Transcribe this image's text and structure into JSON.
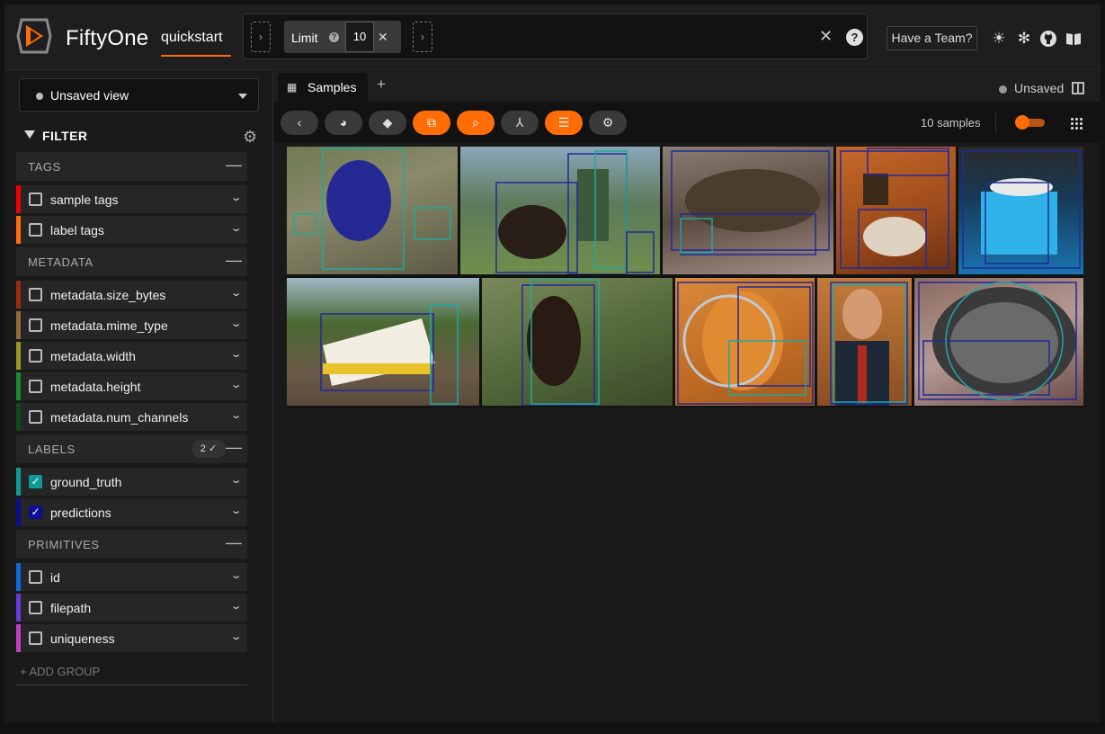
{
  "app": {
    "brand": "FiftyOne",
    "dataset": "quickstart"
  },
  "viewbar": {
    "stage_name": "Limit",
    "stage_value": "10",
    "stage_help": "?",
    "help": "?"
  },
  "header": {
    "team_button": "Have a Team?"
  },
  "sidebar": {
    "view_select": "Unsaved view",
    "filter_title": "FILTER",
    "groups": {
      "tags": "TAGS",
      "metadata": "METADATA",
      "labels": "LABELS",
      "labels_badge": "2 ✓",
      "primitives": "PRIMITIVES"
    },
    "fields": {
      "sample_tags": "sample tags",
      "label_tags": "label tags",
      "size_bytes": "metadata.size_bytes",
      "mime_type": "metadata.mime_type",
      "width": "metadata.width",
      "height": "metadata.height",
      "num_channels": "metadata.num_channels",
      "ground_truth": "ground_truth",
      "predictions": "predictions",
      "id": "id",
      "filepath": "filepath",
      "uniqueness": "uniqueness"
    },
    "add_group": "+ ADD GROUP"
  },
  "main": {
    "tab_label": "Samples",
    "status": "Unsaved",
    "samples_count": "10 samples"
  },
  "colors": {
    "accent": "#ff6d04",
    "tags": "#ee0000",
    "label_tags": "#ff6d04",
    "size_bytes": "#9e2a0f",
    "mime_type": "#9a6b3a",
    "width": "#999922",
    "height": "#1a8a2e",
    "num_channels": "#10491c",
    "ground_truth": "#0f9a97",
    "predictions": "#0b0f8f",
    "id": "#0b6bde",
    "filepath": "#6a3be0",
    "uniqueness": "#c23fbf"
  }
}
